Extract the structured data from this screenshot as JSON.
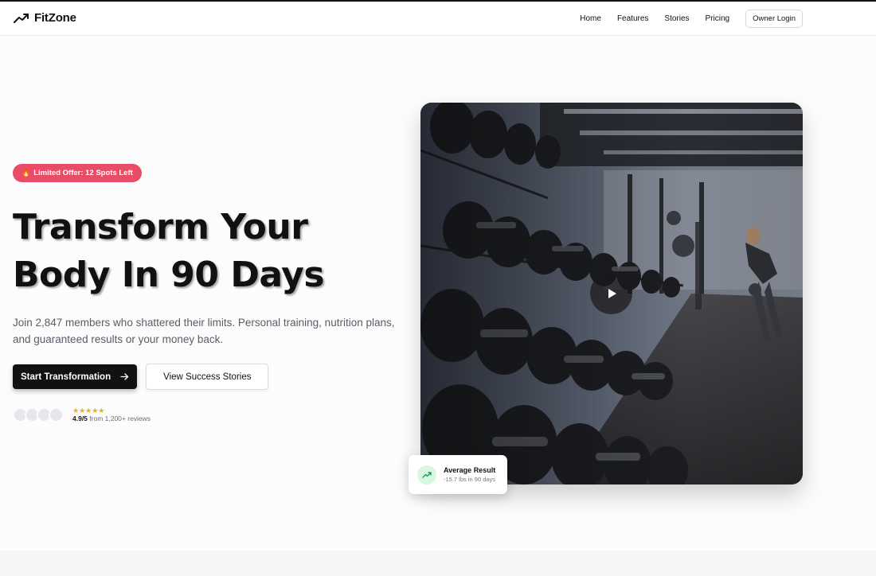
{
  "brand": {
    "name": "FitZone",
    "icon": "trending-up-icon"
  },
  "nav": {
    "links": [
      "Home",
      "Features",
      "Stories",
      "Pricing"
    ],
    "login_label": "Owner Login"
  },
  "hero": {
    "badge": {
      "icon": "flame-icon",
      "text": "Limited Offer: 12 Spots Left"
    },
    "title_line1": "Transform Your",
    "title_line2": "Body In 90 Days",
    "subtitle": "Join 2,847 members who shattered their limits. Personal training, nutrition plans, and guaranteed results or your money back.",
    "primary_cta": {
      "label": "Start Transformation",
      "icon": "arrow-right-icon"
    },
    "secondary_cta": {
      "label": "View Success Stories"
    },
    "rating": {
      "stars": "★★★★★",
      "score": "4.9/5",
      "suffix": "from 1,200+ reviews"
    }
  },
  "media": {
    "play_icon": "play-icon"
  },
  "result_card": {
    "title": "Average Result",
    "subtitle": "-15.7 lbs in 90 days",
    "icon": "trending-up-icon"
  },
  "colors": {
    "accent_badge": "#e94c66",
    "primary": "#111111",
    "star": "#e6b400",
    "result_icon_bg": "#d8f7e1"
  }
}
